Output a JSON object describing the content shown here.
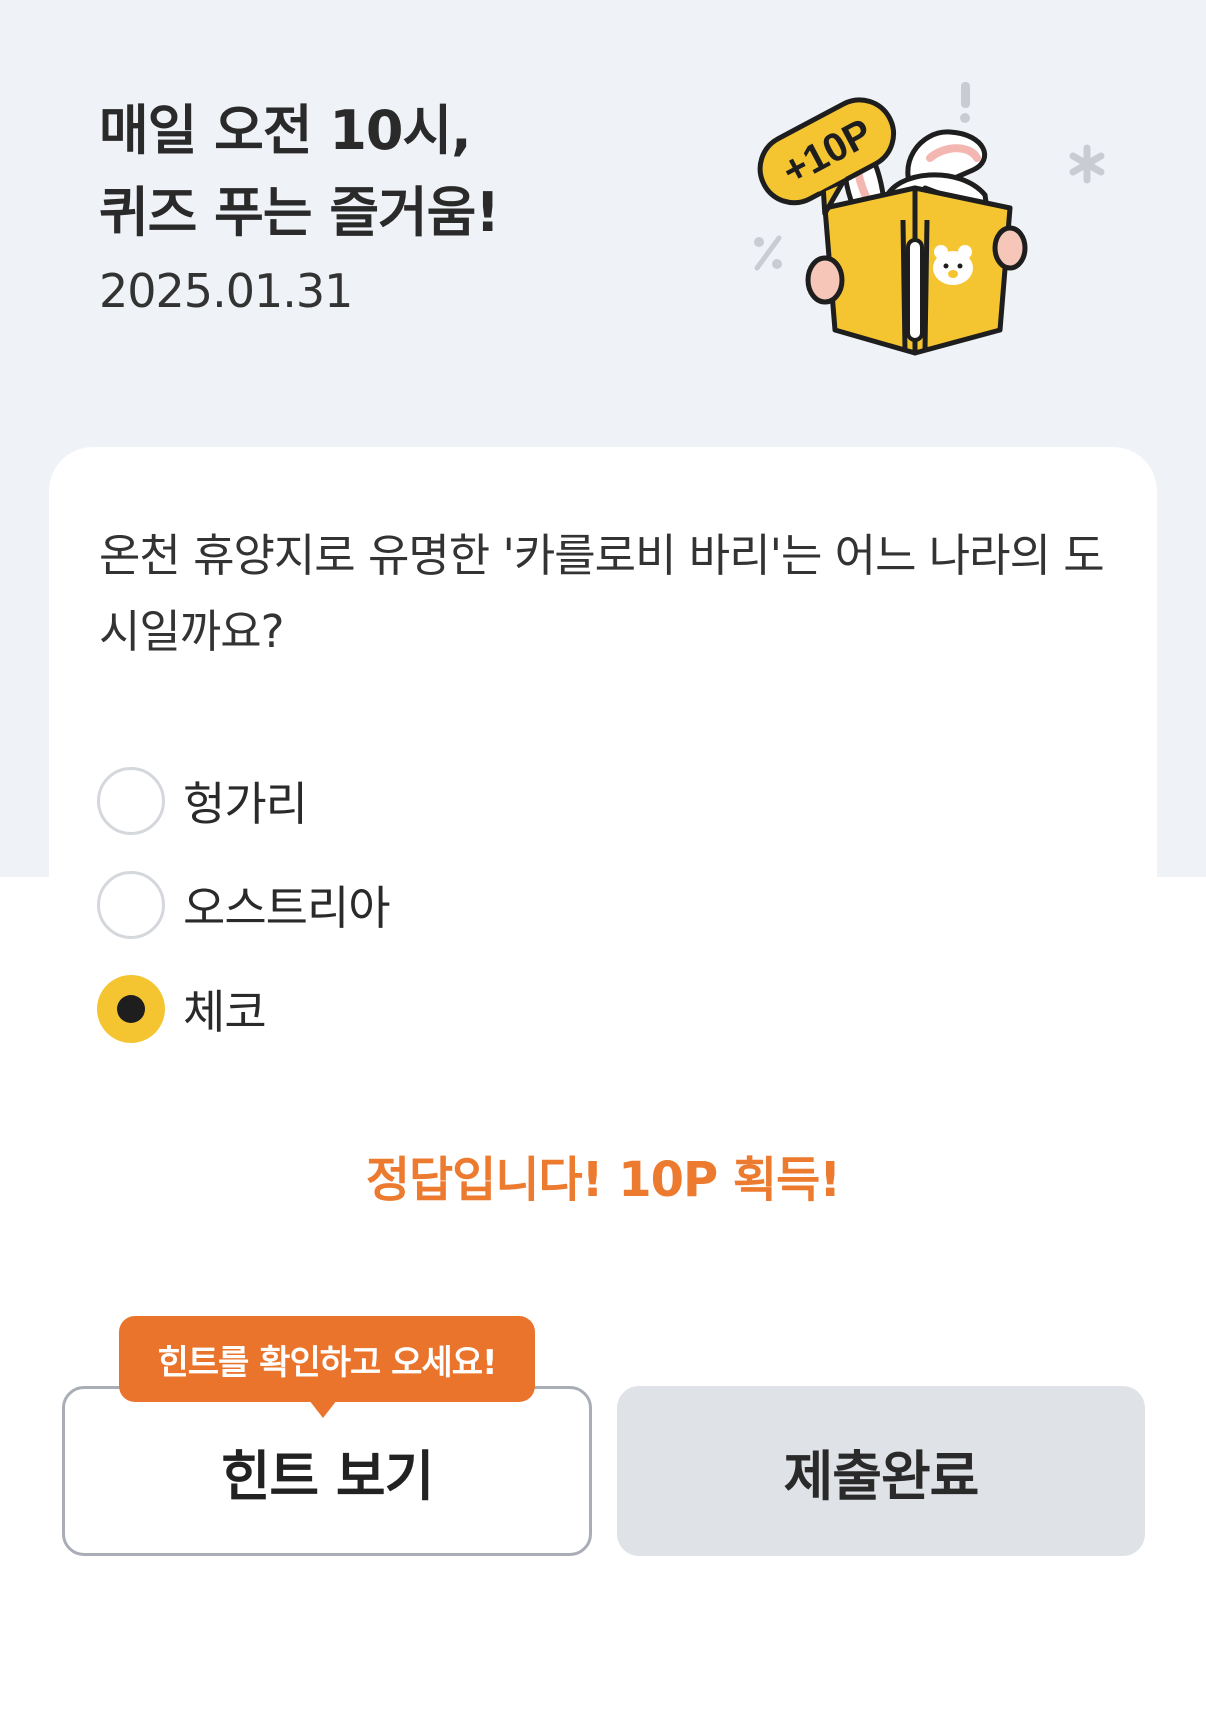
{
  "header": {
    "title_line1": "매일 오전 10시,",
    "title_line2": "퀴즈 푸는 즐거움!",
    "date": "2025.01.31"
  },
  "illustration": {
    "badge": "+10P",
    "icons": [
      "rabbit-reading-book-icon",
      "bear-face-icon",
      "exclamation-icon",
      "asterisk-icon",
      "percent-icon"
    ],
    "colors": {
      "book": "#f5c531",
      "badge": "#f5c531"
    }
  },
  "quiz": {
    "question": "온천 휴양지로 유명한 '카를로비 바리'는 어느 나라의 도시일까요?",
    "options": [
      {
        "label": "헝가리",
        "selected": false
      },
      {
        "label": "오스트리아",
        "selected": false
      },
      {
        "label": "체코",
        "selected": true
      }
    ],
    "result": "정답입니다! 10P 획득!"
  },
  "actions": {
    "hint_tooltip": "힌트를 확인하고 오세요!",
    "hint_button": "힌트 보기",
    "submit_button": "제출완료"
  },
  "colors": {
    "accent_orange": "#ea742c",
    "result_text": "#ec7a2f",
    "radio_selected": "#f5c531",
    "header_bg": "#eff2f7",
    "submit_bg": "#dfe2e6"
  }
}
